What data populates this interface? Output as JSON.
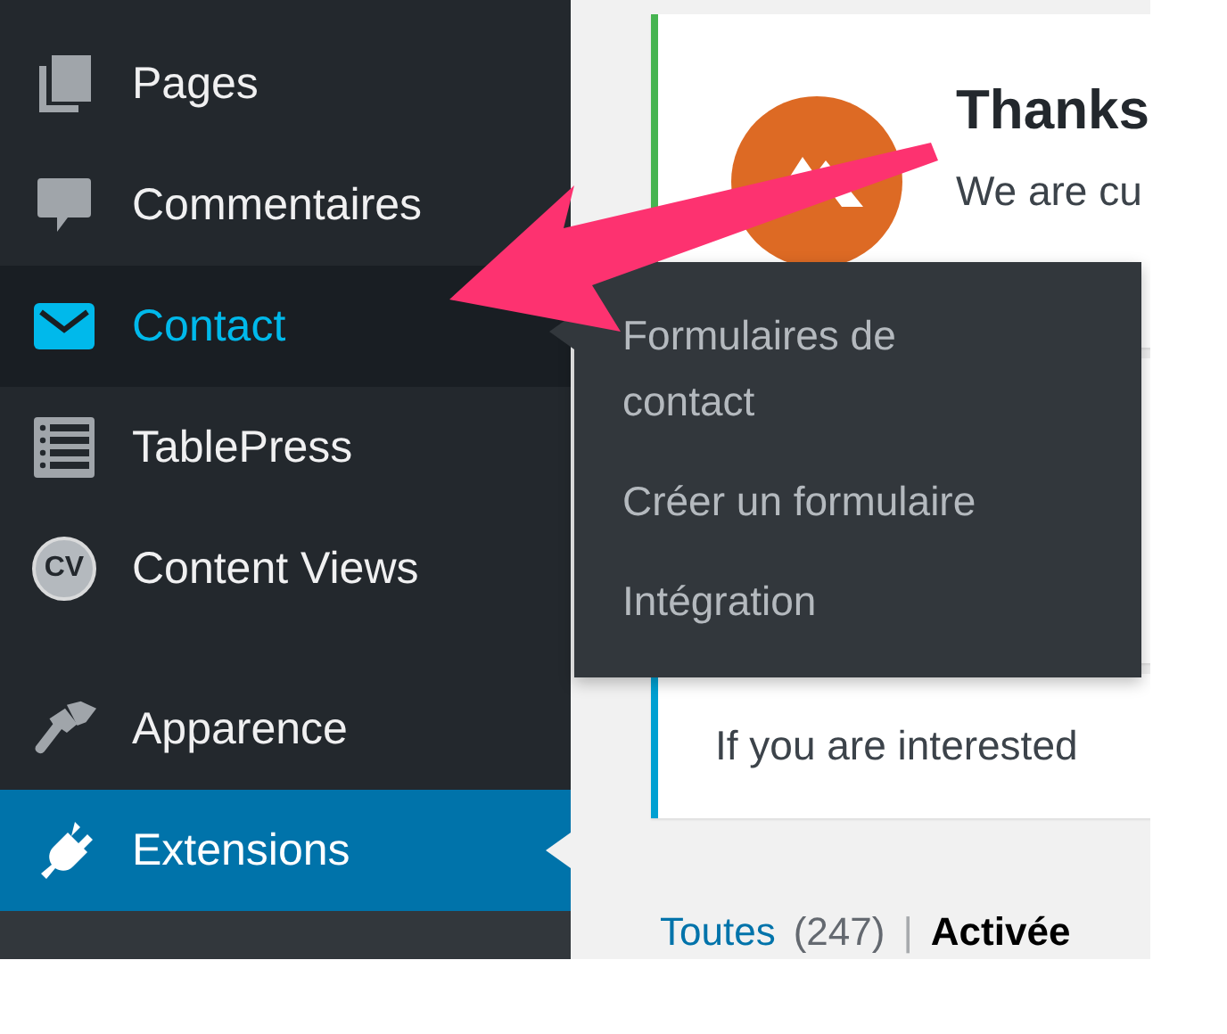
{
  "sidebar": {
    "groups": [
      {
        "items": [
          {
            "label": "Pages",
            "selected": false,
            "expanded": false
          },
          {
            "label": "Commentaires",
            "selected": false,
            "expanded": false
          },
          {
            "label": "Contact",
            "selected": false,
            "expanded": true
          },
          {
            "label": "TablePress",
            "selected": false,
            "expanded": false
          },
          {
            "label": "Content Views",
            "icon_text": "CV",
            "selected": false,
            "expanded": false
          }
        ]
      },
      {
        "items": [
          {
            "label": "Apparence",
            "selected": false,
            "expanded": false
          },
          {
            "label": "Extensions",
            "selected": true,
            "expanded": false
          }
        ]
      }
    ]
  },
  "flyout": {
    "items": [
      "Formulaires de contact",
      "Créer un formulaire",
      "Intégration"
    ]
  },
  "notices": [
    {
      "kind": "logo",
      "color": "#46b450",
      "title": "Thanks",
      "text": "We are cu"
    },
    {
      "kind": "plain"
    },
    {
      "kind": "text",
      "color": "#00a0d2",
      "text": "If you are interested"
    }
  ],
  "filters": {
    "separator": "|",
    "items": [
      {
        "label": "Toutes",
        "count": "(247)",
        "selected": false
      },
      {
        "label": "Activée",
        "selected": true
      }
    ]
  }
}
